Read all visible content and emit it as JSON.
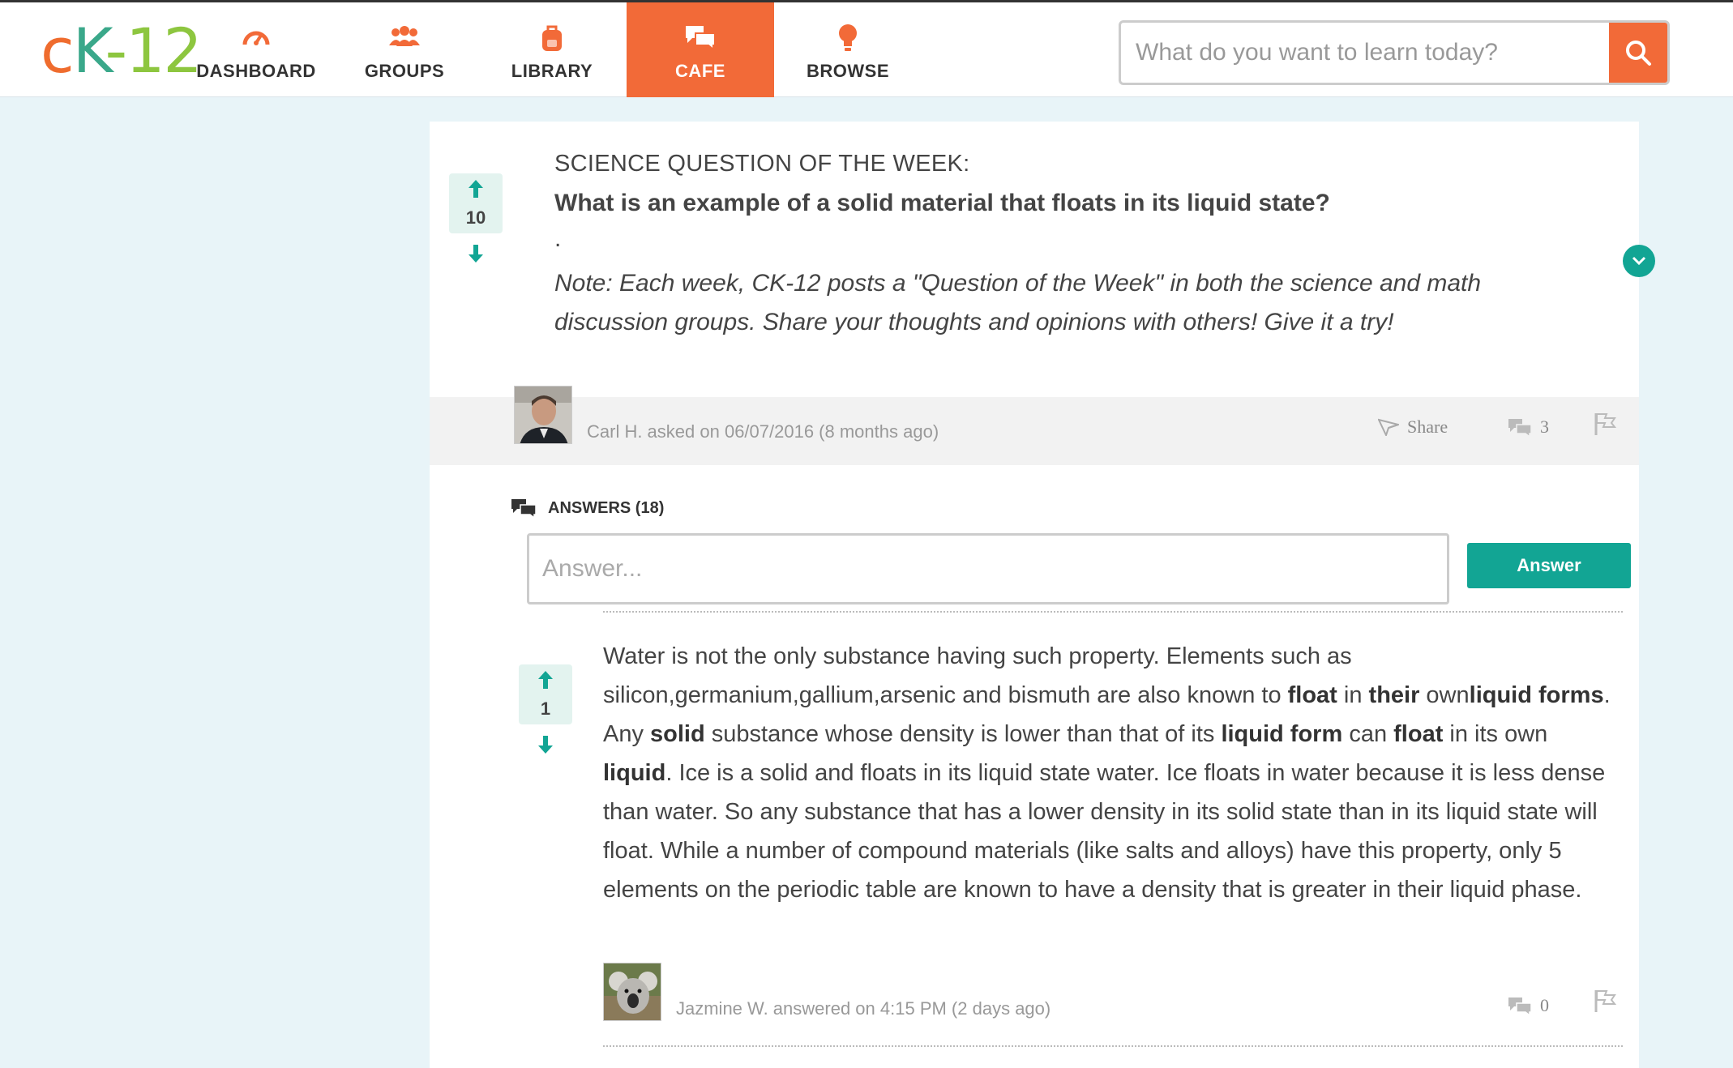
{
  "nav": {
    "logo": {
      "c": "c",
      "k": "K",
      "n": "-12"
    },
    "items": [
      {
        "label": "DASHBOARD",
        "icon": "gauge-icon"
      },
      {
        "label": "GROUPS",
        "icon": "group-icon"
      },
      {
        "label": "LIBRARY",
        "icon": "backpack-icon"
      },
      {
        "label": "CAFE",
        "icon": "chat-bubbles-icon",
        "active": true
      },
      {
        "label": "BROWSE",
        "icon": "lightbulb-icon"
      }
    ],
    "search_placeholder": "What do you want to learn today?"
  },
  "question": {
    "votes": "10",
    "kicker": "SCIENCE QUESTION OF THE WEEK:",
    "title": "What is an example of a solid material that floats in its liquid state?",
    "dot": ".",
    "note": "Note: Each week, CK-12 posts a \"Question of the Week\" in both the science and math discussion groups. Share your thoughts and opinions with others! Give it a try!",
    "meta": "Carl H. asked on 06/07/2016 (8 months ago)",
    "share_label": "Share",
    "comment_count": "3"
  },
  "answers": {
    "heading": "ANSWERS (18)",
    "input_placeholder": "Answer...",
    "submit_label": "Answer",
    "items": [
      {
        "votes": "1",
        "segments": [
          {
            "t": "Water is not the only substance having such property. Elements such as silicon,germanium,gallium,arsenic and bismuth are also known to ",
            "b": false
          },
          {
            "t": "float",
            "b": true
          },
          {
            "t": " in ",
            "b": false
          },
          {
            "t": "their",
            "b": true
          },
          {
            "t": " own",
            "b": false
          },
          {
            "t": "liquid forms",
            "b": true
          },
          {
            "t": ". Any ",
            "b": false
          },
          {
            "t": "solid",
            "b": true
          },
          {
            "t": " substance whose density is lower than that of its ",
            "b": false
          },
          {
            "t": "liquid form",
            "b": true
          },
          {
            "t": " can ",
            "b": false
          },
          {
            "t": "float",
            "b": true
          },
          {
            "t": " in its own ",
            "b": false
          },
          {
            "t": "liquid",
            "b": true
          },
          {
            "t": ". Ice is a solid and floats in its liquid state water. Ice floats in water because it is less dense than water. So any substance that has a lower density in its solid state than in its liquid state will float. While a number of compound materials (like salts and alloys) have this property, only 5 elements on the periodic table are known to have a density that is greater in their liquid phase.",
            "b": false
          }
        ],
        "meta": "Jazmine W. answered on 4:15 PM (2 days ago)",
        "comment_count": "0"
      }
    ]
  },
  "colors": {
    "brand_orange": "#f26a38",
    "teal": "#12a594",
    "vote_bg": "#e3f3ef"
  }
}
